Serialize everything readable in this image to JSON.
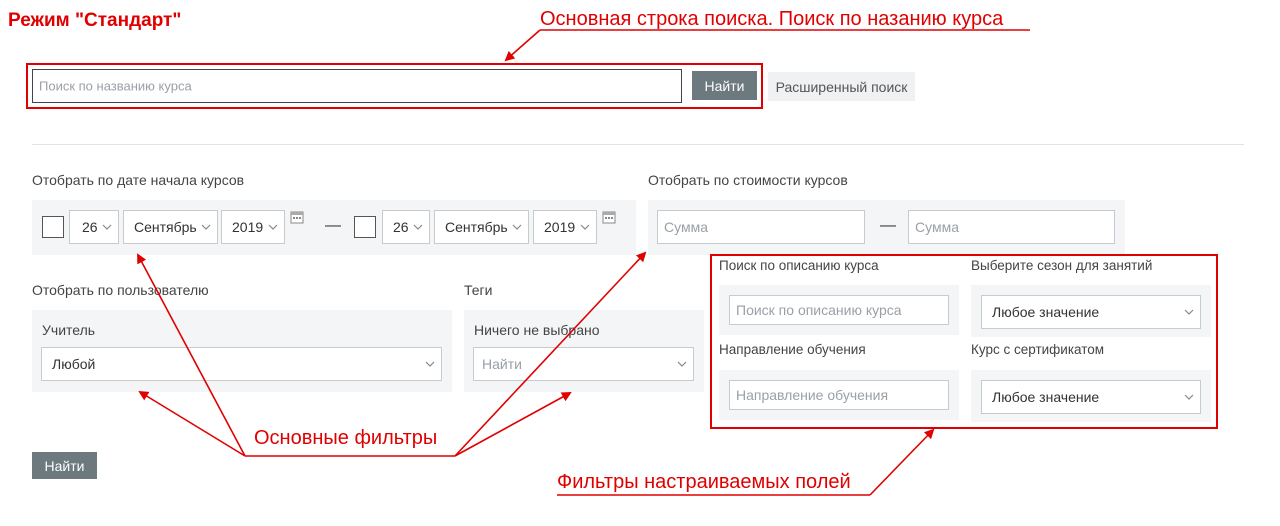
{
  "mode_title": "Режим \"Стандарт\"",
  "annotations": {
    "main_search": "Основная строка поиска. Поиск по назанию курса",
    "main_filters": "Основные фильтры",
    "custom_filters": "Фильтры настраиваемых полей",
    "color": "#e00000"
  },
  "search": {
    "placeholder": "Поиск по названию курса",
    "submit_label": "Найти",
    "advanced_label": "Расширенный поиск"
  },
  "date_filter": {
    "label": "Отобрать по дате начала курсов",
    "from": {
      "day": "26",
      "month": "Сентябрь",
      "year": "2019"
    },
    "to": {
      "day": "26",
      "month": "Сентябрь",
      "year": "2019"
    },
    "separator": "—"
  },
  "price_filter": {
    "label": "Отобрать по стоимости курсов",
    "from_placeholder": "Сумма",
    "to_placeholder": "Сумма",
    "separator": "—"
  },
  "user_filter": {
    "label": "Отобрать по пользователю",
    "role_label": "Учитель",
    "value": "Любой"
  },
  "tags_filter": {
    "label": "Теги",
    "status": "Ничего не выбрано",
    "placeholder": "Найти"
  },
  "custom_fields": {
    "description": {
      "label": "Поиск по описанию курса",
      "placeholder": "Поиск по описанию курса"
    },
    "season": {
      "label": "Выберите сезон для занятий",
      "value": "Любое значение"
    },
    "direction": {
      "label": "Направление обучения",
      "placeholder": "Направление обучения"
    },
    "certificate": {
      "label": "Курс с сертификатом",
      "value": "Любое значение"
    }
  },
  "submit_label": "Найти",
  "colors": {
    "button": "#6c7a80",
    "panel": "#f4f5f6",
    "annotation": "#e00000"
  }
}
